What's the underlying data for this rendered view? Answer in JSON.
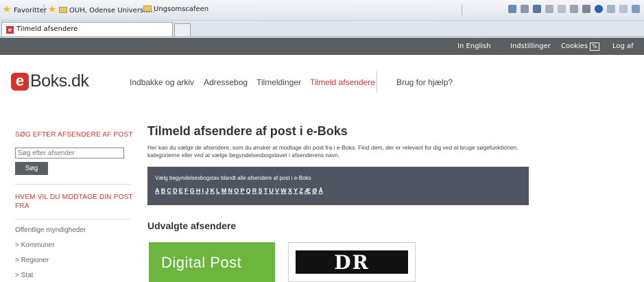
{
  "browser": {
    "favorites_label": "Favoritter",
    "fav_links": [
      "OUH, Odense Universit...",
      "Ungsomscafeen"
    ],
    "tab_title": "Tilmeld afsendere"
  },
  "topbar": {
    "links": [
      "In English",
      "Indstillinger",
      "Cookies",
      "Log af"
    ],
    "cookie_badge": "%"
  },
  "header": {
    "logo_letter": "e",
    "logo_text": "Boks.dk",
    "nav": [
      "Indbakke og arkiv",
      "Adressebog",
      "Tilmeldinger",
      "Tilmeld afsendere",
      "Brug for hjælp?"
    ],
    "active_nav": "Tilmeld afsendere"
  },
  "sidebar": {
    "search_heading": "SØG EFTER AFSENDERE AF POST",
    "search_placeholder": "Søg efter afsender",
    "search_button": "Søg",
    "who_heading_line1": "HVEM VIL DU MODTAGE DIN POST",
    "who_heading_line2": "FRA",
    "items": [
      "Offentlige myndigheder",
      "> Kommuner",
      "> Regioner",
      "> Stat"
    ]
  },
  "main": {
    "title": "Tilmeld afsendere af post i e-Boks",
    "intro": "Her kan du vælge de afsendere, som du ønsker at modtage din post fra i e-Boks. Find dem, der er relevant for dig ved at bruge søgefunktionen, kategorierne eller ved at vælge begyndelsesbogstavet i afsenderens navn.",
    "alphabet_label": "Vælg begyndelsesbogstav blandt alle afsendere af post i e-Boks",
    "letters": [
      "A",
      "B",
      "C",
      "D",
      "E",
      "F",
      "G",
      "H",
      "I",
      "J",
      "K",
      "L",
      "M",
      "N",
      "O",
      "P",
      "Q",
      "R",
      "S",
      "T",
      "U",
      "V",
      "W",
      "X",
      "Y",
      "Z",
      "Æ",
      "Ø",
      "Å"
    ],
    "selected_title": "Udvalgte afsendere",
    "tiles": [
      "Digital Post",
      "DR"
    ]
  },
  "colors": {
    "brand_red": "#d6342b",
    "topbar_gray": "#5a5f63",
    "digital_post_green": "#6cb53e"
  }
}
